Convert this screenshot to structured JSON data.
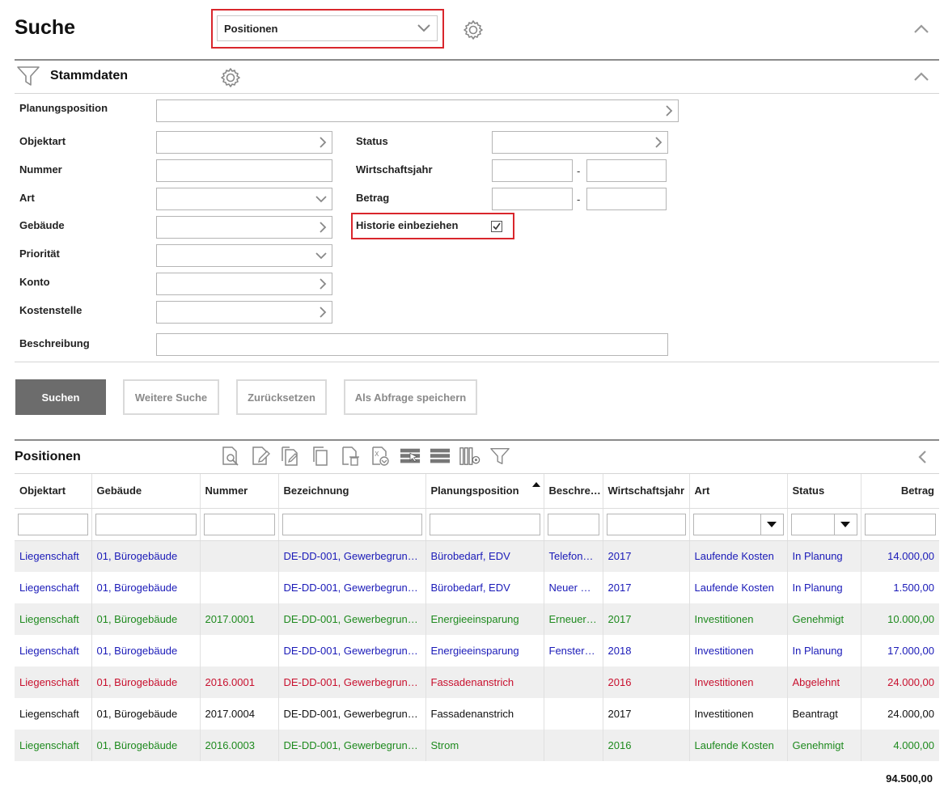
{
  "header": {
    "title": "Suche",
    "search_type": "Positionen"
  },
  "stammdaten": {
    "title": "Stammdaten",
    "labels": {
      "planungsposition": "Planungsposition",
      "objektart": "Objektart",
      "nummer": "Nummer",
      "art": "Art",
      "gebaeude": "Gebäude",
      "prioritaet": "Priorität",
      "konto": "Konto",
      "kostenstelle": "Kostenstelle",
      "beschreibung": "Beschreibung",
      "status": "Status",
      "wirtschaftsjahr": "Wirtschaftsjahr",
      "betrag": "Betrag",
      "historie": "Historie einbeziehen"
    },
    "range_separator": "-",
    "historie_checked": true
  },
  "buttons": {
    "suchen": "Suchen",
    "weitere_suche": "Weitere Suche",
    "zuruecksetzen": "Zurücksetzen",
    "als_abfrage_speichern": "Als Abfrage speichern"
  },
  "results": {
    "title": "Positionen",
    "columns": [
      "Objektart",
      "Gebäude",
      "Nummer",
      "Bezeichnung",
      "Planungsposition",
      "Beschre…",
      "Wirtschaftsjahr",
      "Art",
      "Status",
      "Betrag"
    ],
    "sorted_column": "Planungsposition",
    "rows": [
      {
        "color": "blue",
        "cells": [
          "Liegenschaft",
          "01, Bürogebäude",
          "",
          "DE-DD-001, Gewerbegrund…",
          "Bürobedarf, EDV",
          "Telefona…",
          "2017",
          "Laufende Kosten",
          "In Planung",
          "14.000,00"
        ]
      },
      {
        "color": "blue",
        "cells": [
          "Liegenschaft",
          "01, Bürogebäude",
          "",
          "DE-DD-001, Gewerbegrund…",
          "Bürobedarf, EDV",
          "Neuer S…",
          "2017",
          "Laufende Kosten",
          "In Planung",
          "1.500,00"
        ]
      },
      {
        "color": "green",
        "cells": [
          "Liegenschaft",
          "01, Bürogebäude",
          "2017.0001",
          "DE-DD-001, Gewerbegrund…",
          "Energieeinsparung",
          "Erneuer…",
          "2017",
          "Investitionen",
          "Genehmigt",
          "10.000,00"
        ]
      },
      {
        "color": "blue",
        "cells": [
          "Liegenschaft",
          "01, Bürogebäude",
          "",
          "DE-DD-001, Gewerbegrund…",
          "Energieeinsparung",
          "Fenster …",
          "2018",
          "Investitionen",
          "In Planung",
          "17.000,00"
        ]
      },
      {
        "color": "red",
        "cells": [
          "Liegenschaft",
          "01, Bürogebäude",
          "2016.0001",
          "DE-DD-001, Gewerbegrund…",
          "Fassadenanstrich",
          "",
          "2016",
          "Investitionen",
          "Abgelehnt",
          "24.000,00"
        ]
      },
      {
        "color": "black",
        "cells": [
          "Liegenschaft",
          "01, Bürogebäude",
          "2017.0004",
          "DE-DD-001, Gewerbegrund…",
          "Fassadenanstrich",
          "",
          "2017",
          "Investitionen",
          "Beantragt",
          "24.000,00"
        ]
      },
      {
        "color": "green",
        "cells": [
          "Liegenschaft",
          "01, Bürogebäude",
          "2016.0003",
          "DE-DD-001, Gewerbegrund…",
          "Strom",
          "",
          "2016",
          "Laufende Kosten",
          "Genehmigt",
          "4.000,00"
        ]
      }
    ],
    "total": "94.500,00"
  },
  "colors": {
    "blue": "#1a1ab8",
    "green": "#1e8a1e",
    "red": "#c8102e",
    "black": "#111111",
    "highlight": "#d9262c",
    "primary_button": "#6c6c6c"
  },
  "icons": {
    "settings": "gear-icon",
    "filter": "funnel-icon",
    "collapse": "chevron-up-icon",
    "expand": "chevron-right-icon",
    "dropdown": "chevron-down-icon"
  }
}
